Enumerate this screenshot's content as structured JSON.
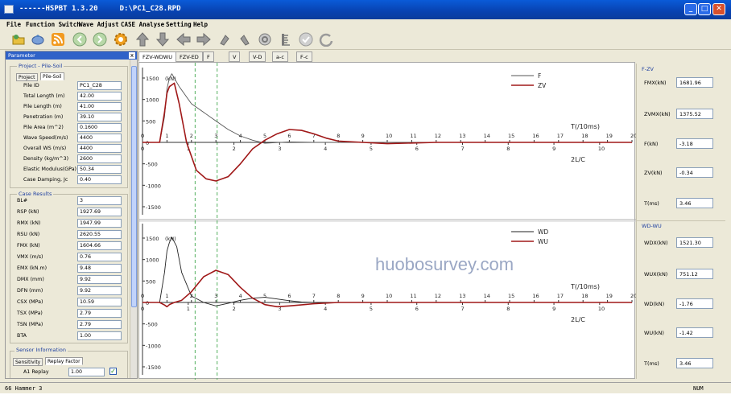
{
  "window": {
    "title": "------HSPBT 1.3.20     D:\\PC1_C28.RPD",
    "min": "_",
    "max": "□",
    "close": "✕"
  },
  "menu": [
    "File",
    "Function Switch",
    "Wave Adjust",
    "CASE Analyse",
    "Setting",
    "Help"
  ],
  "toolbar": {
    "icons": [
      "folder-icon",
      "save-icon",
      "rss-icon",
      "back-icon",
      "forward-icon",
      "gear-icon",
      "arrow-up-icon",
      "arrow-down-icon",
      "arrow-left-icon",
      "arrow-right-icon",
      "rotate-left-icon",
      "rotate-right-icon",
      "reset-icon",
      "ruler-icon",
      "check-icon",
      "refresh-icon"
    ],
    "colors": {
      "accent": "#f0a020",
      "gray": "#8c8c8c"
    }
  },
  "left_panel": {
    "header": "Parameter",
    "close": "x",
    "project_title": "Project - Pile-Soil",
    "tabs": [
      "Project",
      "Pile-Soil"
    ],
    "params": [
      {
        "label": "Pile ID",
        "value": "PC1_C28"
      },
      {
        "label": "Total Length (m)",
        "value": "42.00"
      },
      {
        "label": "Pile Length (m)",
        "value": "41.00"
      },
      {
        "label": "Penetration (m)",
        "value": "39.10"
      },
      {
        "label": "Pile Area (m^2)",
        "value": "0.1600"
      },
      {
        "label": "Wave Speed(m/s)",
        "value": "4400"
      },
      {
        "label": "Overall WS (m/s)",
        "value": "4400"
      },
      {
        "label": "Density (kg/m^3)",
        "value": "2600"
      },
      {
        "label": "Elastic Modulus(GPa)",
        "value": "50.34"
      },
      {
        "label": "Case Damping, Jc",
        "value": "0.40"
      }
    ],
    "case_title": "Case Results",
    "case_results": [
      {
        "label": "BL#",
        "value": "3"
      },
      {
        "label": "RSP (kN)",
        "value": "1927.69"
      },
      {
        "label": "RMX (kN)",
        "value": "1947.99"
      },
      {
        "label": "RSU (kN)",
        "value": "2620.55"
      },
      {
        "label": "FMX (kN)",
        "value": "1604.66"
      },
      {
        "label": "VMX (m/s)",
        "value": "0.76"
      },
      {
        "label": "EMX (kN.m)",
        "value": "9.48"
      },
      {
        "label": "DMX (mm)",
        "value": "9.92"
      },
      {
        "label": "DFN (mm)",
        "value": "9.92"
      },
      {
        "label": "CSX (MPa)",
        "value": "10.59"
      },
      {
        "label": "TSX (MPa)",
        "value": "2.79"
      },
      {
        "label": "TSN (MPa)",
        "value": "2.79"
      },
      {
        "label": "BTA",
        "value": "1.00"
      }
    ],
    "sensor_title": "Sensor Information",
    "sensor_tabs": [
      "Sensitivity",
      "Replay Factor"
    ],
    "sensor_row": {
      "label": "A1 Replay",
      "value": "1.00"
    }
  },
  "chart_tabs": [
    "FZV-WDWU",
    "FZV-ED",
    "F",
    "V",
    "V-D",
    "a-c",
    "F-c"
  ],
  "right_panel": {
    "fzv_title": "F-ZV",
    "fzv": [
      {
        "label": "FMX(kN)",
        "value": "1681.96"
      },
      {
        "label": "ZVMX(kN)",
        "value": "1375.52"
      },
      {
        "label": "F(kN)",
        "value": "-3.18"
      },
      {
        "label": "ZV(kN)",
        "value": "-0.34"
      },
      {
        "label": "T(ms)",
        "value": "3.46"
      }
    ],
    "wdwu_title": "WD-WU",
    "wdwu": [
      {
        "label": "WDX(kN)",
        "value": "1521.30"
      },
      {
        "label": "WUX(kN)",
        "value": "751.12"
      },
      {
        "label": "WD(kN)",
        "value": "-1.76"
      },
      {
        "label": "WU(kN)",
        "value": "-1.42"
      },
      {
        "label": "T(ms)",
        "value": "3.46"
      }
    ]
  },
  "status": {
    "left": "66 Hammer 3",
    "right": "NUM"
  },
  "watermark": "huobosurvey.com",
  "chart_data": [
    {
      "type": "line",
      "ylabel": "(kN)",
      "xlabel_top": "T(/10ms)",
      "xlabel_bottom": "2L/C",
      "ylim": [
        -1500,
        1500
      ],
      "yticks": [
        "1500",
        "1000",
        "500",
        "0",
        "-500",
        "-1000",
        "-1500"
      ],
      "x_top_ticks": [
        "0",
        "1",
        "2",
        "3",
        "4",
        "5",
        "6",
        "7",
        "8",
        "9",
        "10",
        "11",
        "12",
        "13",
        "14",
        "15",
        "16",
        "17",
        "18",
        "19",
        "20"
      ],
      "x_bottom_ticks": [
        "0",
        "1",
        "2",
        "3",
        "4",
        "5",
        "6",
        "7",
        "8",
        "9",
        "10"
      ],
      "series": [
        {
          "name": "F",
          "color": "#555555",
          "x": [
            0,
            0.7,
            0.9,
            1.0,
            1.1,
            1.2,
            1.5,
            2.0,
            2.5,
            3.0,
            3.5,
            4.0,
            4.5,
            5.0,
            6.0,
            7.0,
            8.0,
            10,
            12,
            14,
            20
          ],
          "y": [
            0,
            0,
            600,
            1250,
            1500,
            1600,
            1300,
            900,
            700,
            500,
            300,
            150,
            50,
            -20,
            10,
            0,
            0,
            0,
            0,
            0,
            0
          ]
        },
        {
          "name": "ZV",
          "color": "#a01818",
          "x": [
            0,
            0.7,
            0.9,
            1.0,
            1.1,
            1.3,
            1.5,
            1.8,
            2.2,
            2.6,
            3.0,
            3.5,
            4.0,
            4.5,
            5.0,
            5.5,
            6.0,
            6.5,
            7.0,
            7.5,
            8.0,
            9.0,
            10,
            12,
            14,
            20
          ],
          "y": [
            0,
            0,
            700,
            1150,
            1300,
            1380,
            900,
            0,
            -650,
            -850,
            -900,
            -800,
            -500,
            -150,
            50,
            200,
            300,
            280,
            200,
            100,
            30,
            0,
            -30,
            0,
            0,
            0
          ]
        }
      ]
    },
    {
      "type": "line",
      "ylabel": "(kN)",
      "xlabel_top": "T(/10ms)",
      "xlabel_bottom": "2L/C",
      "ylim": [
        -1500,
        1500
      ],
      "yticks": [
        "1500",
        "1000",
        "500",
        "0",
        "-500",
        "-1000",
        "-1500"
      ],
      "x_top_ticks": [
        "0",
        "1",
        "2",
        "3",
        "4",
        "5",
        "6",
        "7",
        "8",
        "9",
        "10",
        "11",
        "12",
        "13",
        "14",
        "15",
        "16",
        "17",
        "18",
        "19",
        "20"
      ],
      "x_bottom_ticks": [
        "0",
        "1",
        "2",
        "3",
        "4",
        "5",
        "6",
        "7",
        "8",
        "9",
        "10"
      ],
      "series": [
        {
          "name": "WD",
          "color": "#222222",
          "x": [
            0,
            0.7,
            0.9,
            1.0,
            1.1,
            1.2,
            1.4,
            1.6,
            2.0,
            2.5,
            3.0,
            3.5,
            4.0,
            4.5,
            5.0,
            5.5,
            6.0,
            6.5,
            7.0,
            8.0,
            10,
            12,
            20
          ],
          "y": [
            0,
            0,
            700,
            1200,
            1400,
            1520,
            1300,
            700,
            150,
            0,
            -80,
            -20,
            50,
            100,
            120,
            80,
            40,
            10,
            0,
            0,
            0,
            0,
            0
          ]
        },
        {
          "name": "WU",
          "color": "#a01818",
          "x": [
            0,
            0.7,
            0.9,
            1.0,
            1.1,
            1.3,
            1.6,
            2.0,
            2.5,
            3.0,
            3.5,
            4.0,
            4.5,
            5.0,
            5.5,
            6.0,
            7.0,
            8.0,
            10,
            12,
            20
          ],
          "y": [
            0,
            0,
            -60,
            -100,
            -50,
            0,
            50,
            250,
            600,
            750,
            650,
            350,
            100,
            -50,
            -100,
            -80,
            -30,
            0,
            0,
            0,
            0
          ]
        }
      ]
    }
  ]
}
